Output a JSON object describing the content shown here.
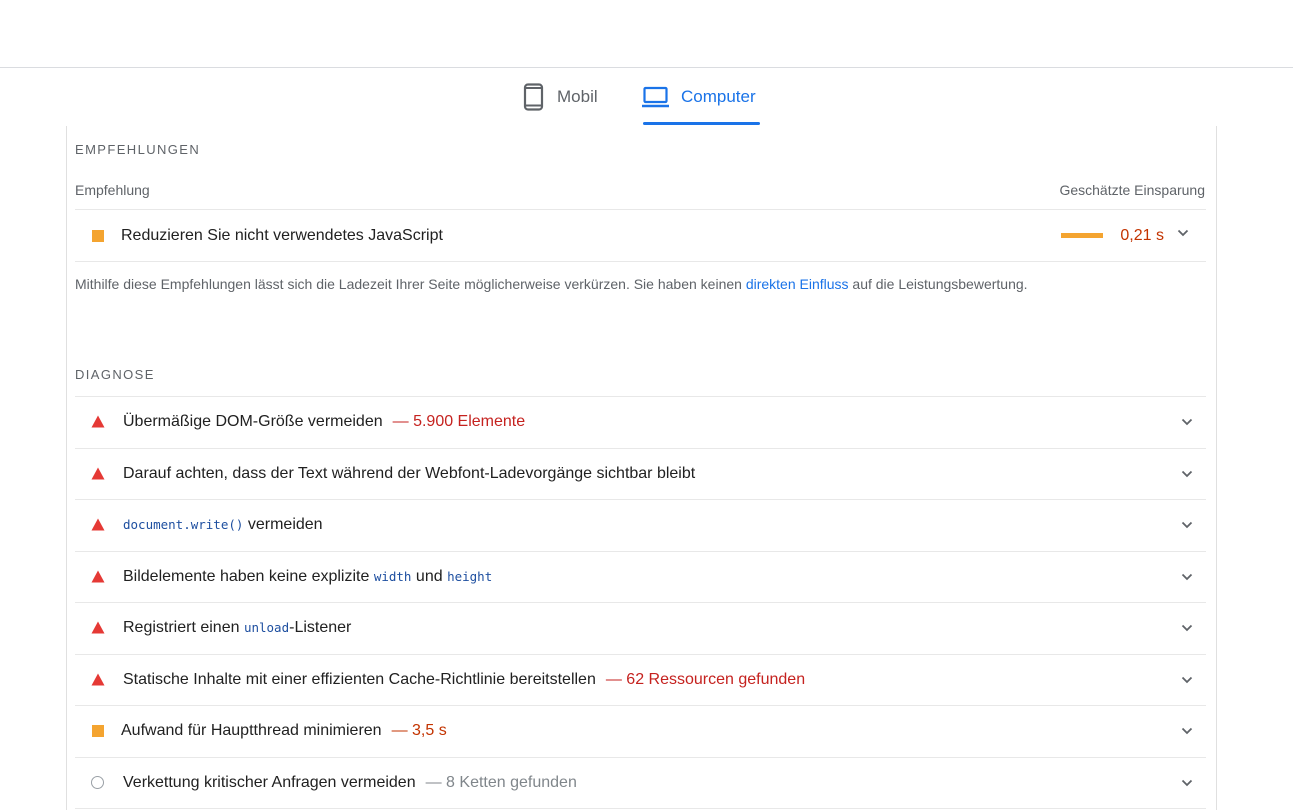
{
  "tabs": {
    "mobile": {
      "label": "Mobil",
      "icon": "smartphone-icon"
    },
    "desktop": {
      "label": "Computer",
      "icon": "laptop-icon",
      "active": true
    }
  },
  "opportunities": {
    "section_title": "EMPFEHLUNGEN",
    "col_left": "Empfehlung",
    "col_right": "Geschätzte Einsparung",
    "items": [
      {
        "label": "Reduzieren Sie nicht verwendetes JavaScript",
        "savings": "0,21 s",
        "severity": "average"
      }
    ],
    "note_before": "Mithilfe diese Empfehlungen lässt sich die Ladezeit Ihrer Seite möglicherweise verkürzen. Sie haben keinen ",
    "note_link": "direkten Einfluss",
    "note_after": " auf die Leistungsbewertung."
  },
  "diagnostics": {
    "section_title": "DIAGNOSE",
    "items": [
      {
        "label": "Übermäßige DOM-Größe vermeiden",
        "detail": "— 5.900 Elemente",
        "severity": "fail"
      },
      {
        "label": "Darauf achten, dass der Text während der Webfont-Ladevorgänge sichtbar bleibt",
        "severity": "fail"
      },
      {
        "code": "document.write()",
        "label_after": " vermeiden",
        "severity": "fail"
      },
      {
        "label_before": "Bildelemente haben keine explizite ",
        "code1": "width",
        "label_mid": " und ",
        "code2": "height",
        "severity": "fail"
      },
      {
        "label_before": "Registriert einen ",
        "code": "unload",
        "label_after": "-Listener",
        "severity": "fail"
      },
      {
        "label": "Statische Inhalte mit einer effizienten Cache-Richtlinie bereitstellen",
        "detail": "— 62 Ressourcen gefunden",
        "severity": "fail"
      },
      {
        "label": "Aufwand für Hauptthread minimieren",
        "detail": "— 3,5 s",
        "severity": "average"
      },
      {
        "label": "Verkettung kritischer Anfragen vermeiden",
        "detail": "— 8 Ketten gefunden",
        "severity": "info"
      }
    ]
  },
  "colors": {
    "fail": "#e53935",
    "average": "#f4a430",
    "info": "#9aa0a6",
    "accent": "#1a73e8"
  }
}
